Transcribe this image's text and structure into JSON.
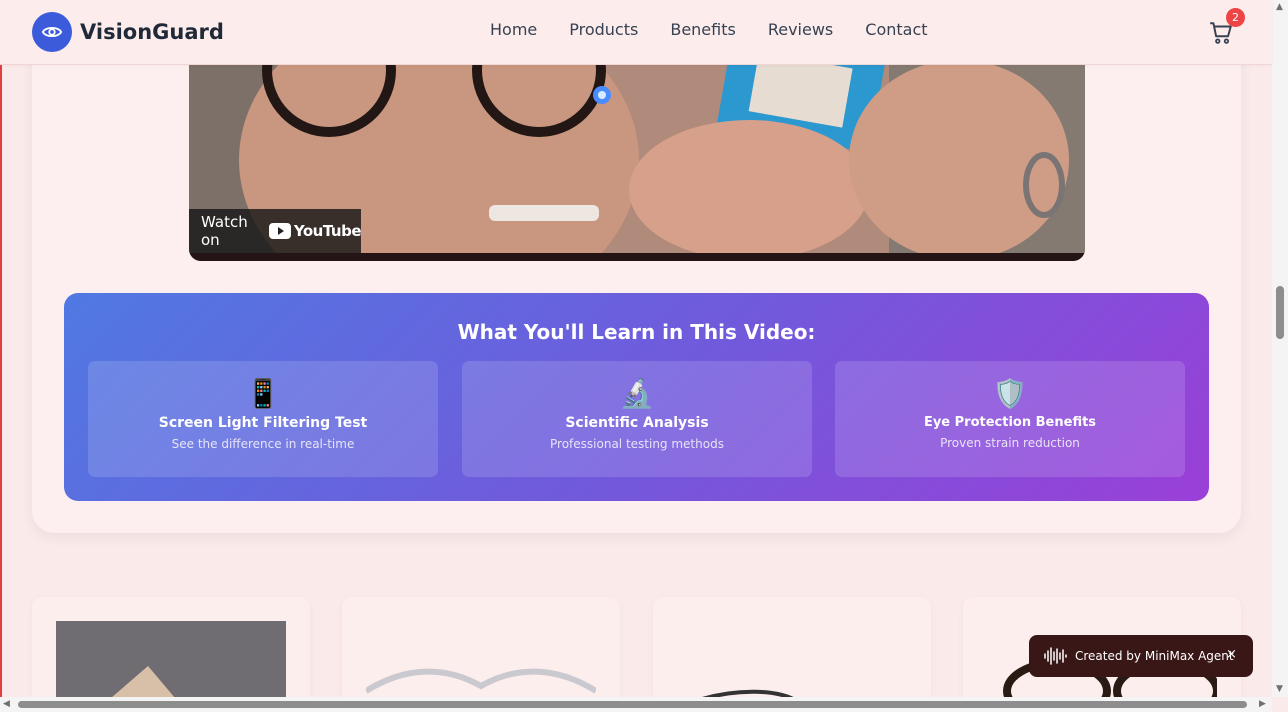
{
  "header": {
    "brand": "VisionGuard",
    "nav": [
      "Home",
      "Products",
      "Benefits",
      "Reviews",
      "Contact"
    ],
    "cart_count": "2",
    "cart_icon": "shopping-cart-icon",
    "logo_icon": "eye-icon"
  },
  "video": {
    "watch_label": "Watch on",
    "youtube_label": "YouTube"
  },
  "learn": {
    "title": "What You'll Learn in This Video:",
    "features": [
      {
        "icon": "📱",
        "title": "Screen Light Filtering Test",
        "subtitle": "See the difference in real-time"
      },
      {
        "icon": "🔬",
        "title": "Scientific Analysis",
        "subtitle": "Professional testing methods"
      },
      {
        "icon": "🛡️",
        "title": "Eye Protection Benefits",
        "subtitle": "Proven strain reduction"
      }
    ]
  },
  "toast": {
    "text": "Created by MiniMax Agent",
    "close": "×"
  },
  "colors": {
    "accent": "#3b5bdb",
    "badge": "#ef4444",
    "gradient_start": "#5079e2",
    "gradient_end": "#9a3fd8"
  }
}
